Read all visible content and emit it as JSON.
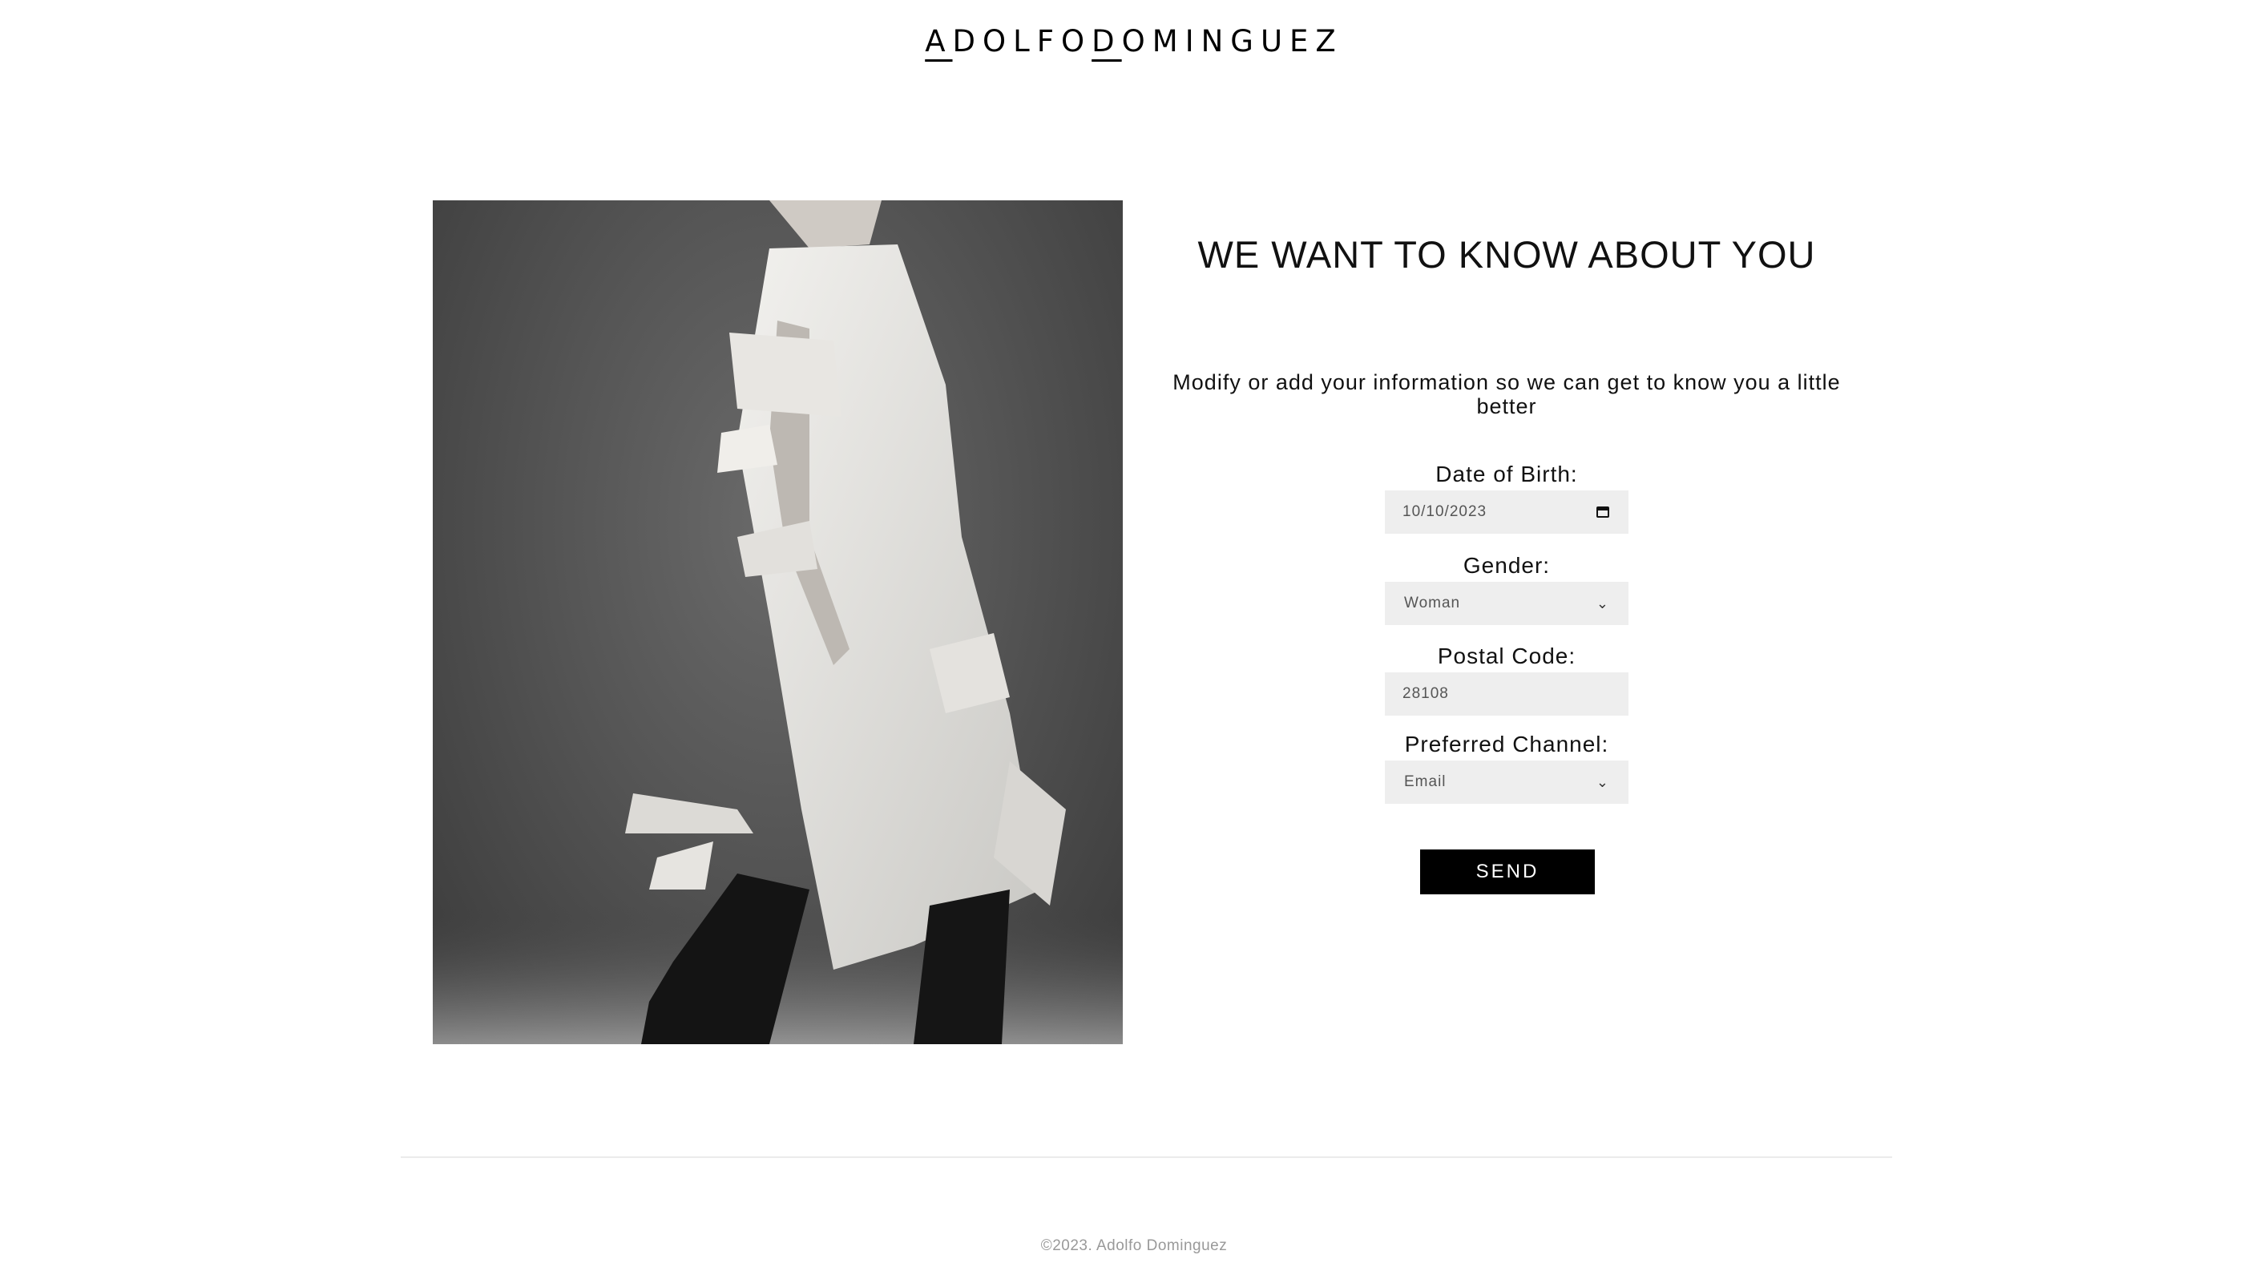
{
  "header": {
    "logo_part1": "A",
    "logo_part2": "DOLFO",
    "logo_part3": "D",
    "logo_part4": "OMINGUEZ"
  },
  "image": {
    "alt": "Model wearing white sculptural paper-strip dress and black boots"
  },
  "form": {
    "title": "WE WANT TO KNOW ABOUT YOU",
    "subtitle": "Modify or add your information so we can get to know you a little better",
    "dob_label": "Date of Birth:",
    "dob_value": "10/10/2023",
    "gender_label": "Gender:",
    "gender_value": "Woman",
    "postal_label": "Postal Code:",
    "postal_value": "28108",
    "channel_label": "Preferred Channel:",
    "channel_value": "Email",
    "send_label": "SEND"
  },
  "footer": {
    "copyright": "©2023. Adolfo Dominguez"
  },
  "colors": {
    "input_bg": "#eeeeee",
    "button_bg": "#000000",
    "footer_text": "#999999"
  }
}
